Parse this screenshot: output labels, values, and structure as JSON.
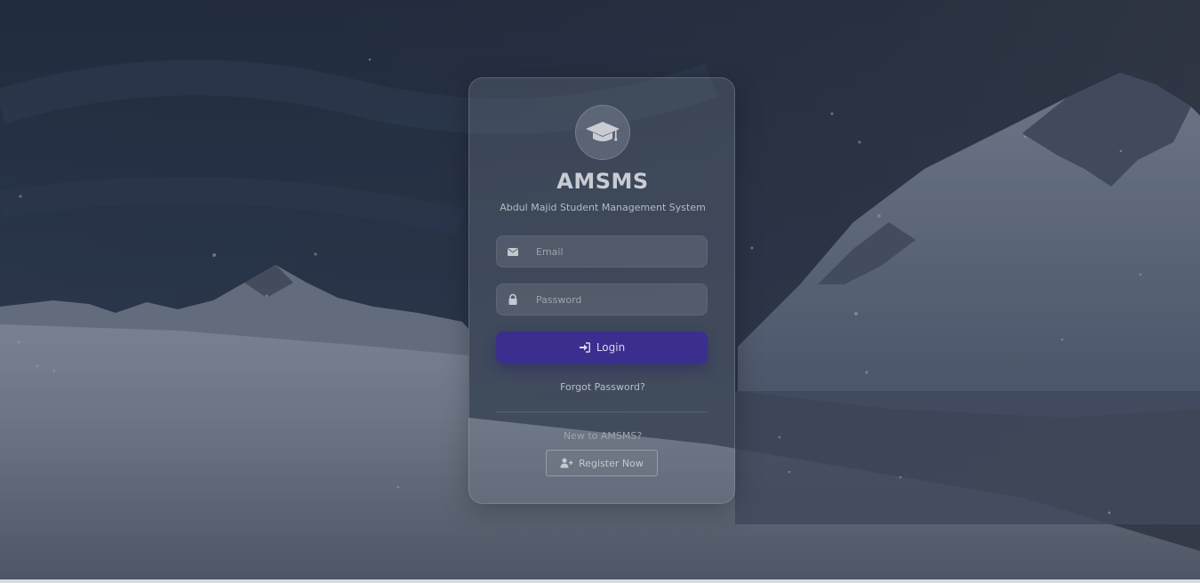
{
  "app": {
    "title": "AMSMS",
    "subtitle": "Abdul Majid Student Management System",
    "logo_icon": "graduation-cap-icon"
  },
  "form": {
    "email": {
      "placeholder": "Email",
      "value": "",
      "icon": "envelope-icon"
    },
    "password": {
      "placeholder": "Password",
      "value": "",
      "icon": "lock-icon"
    },
    "login_label": "Login",
    "login_icon": "sign-in-icon",
    "forgot_label": "Forgot Password?"
  },
  "register": {
    "prompt": "New to AMSMS?",
    "button_label": "Register Now",
    "button_icon": "user-plus-icon"
  },
  "colors": {
    "accent": "#3a2f8e",
    "card": "#6f7685",
    "background": "#2a3444"
  }
}
